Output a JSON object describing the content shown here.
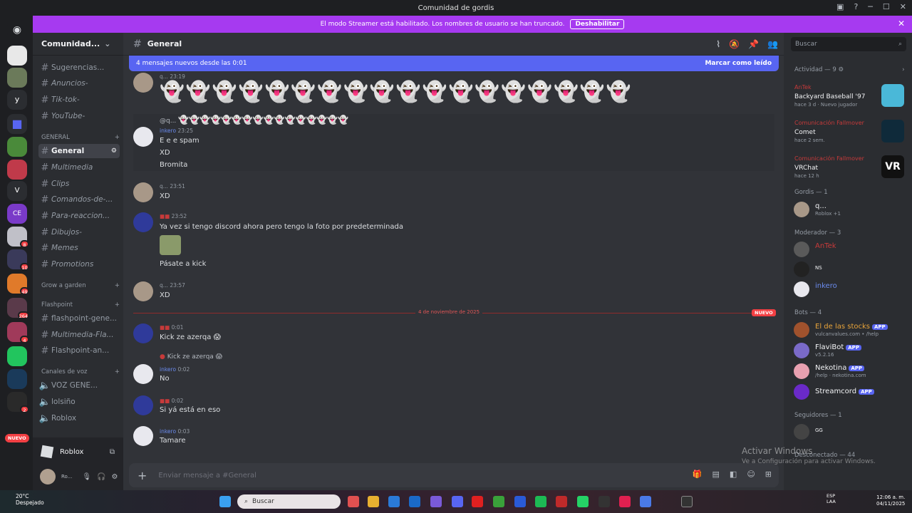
{
  "titlebar": {
    "title": "Comunidad de gordis"
  },
  "banner": {
    "text": "El modo Streamer está habilitado. Los nombres de usuario se han truncado.",
    "button": "Deshabilitar"
  },
  "server": {
    "name": "Comunidad..."
  },
  "channels": {
    "top": [
      {
        "name": "Sugerencias..."
      },
      {
        "name": "Anuncios-"
      },
      {
        "name": "Tik-tok-"
      },
      {
        "name": "YouTube-"
      }
    ],
    "cat_general": "GENERAL",
    "general": [
      {
        "name": "General"
      },
      {
        "name": "Multimedia"
      },
      {
        "name": "Clips"
      },
      {
        "name": "Comandos-de-..."
      },
      {
        "name": "Para-reaccion..."
      },
      {
        "name": "Dibujos-"
      },
      {
        "name": "Memes"
      },
      {
        "name": "Promotions"
      }
    ],
    "cat_grow": "Grow a garden",
    "cat_flash": "Flashpoint",
    "flash": [
      {
        "name": "flashpoint-gene..."
      },
      {
        "name": "Multimedia-Fla..."
      },
      {
        "name": "Flashpoint-an..."
      }
    ],
    "cat_voice": "Canales de voz",
    "voice": [
      {
        "name": "VOZ GENE..."
      },
      {
        "name": "lolsiño"
      },
      {
        "name": "Roblox"
      }
    ]
  },
  "rail": {
    "nuevo": "NUEVO",
    "badges": [
      "8",
      "10",
      "49",
      "264",
      "4",
      "2"
    ]
  },
  "voice_panel": {
    "activity": "Roblox"
  },
  "user_panel": {
    "status": "Ro..."
  },
  "channel_header": {
    "name": "General"
  },
  "new_messages": {
    "text": "4 mensajes nuevos desde las 0:01",
    "mark": "Marcar como leído"
  },
  "messages": {
    "m0_time": "23:19",
    "m0_author": "q...",
    "m1_reply_author": "@q...",
    "m1_author": "inkero",
    "m1_time": "23:25",
    "m1_l1": "E e e spam",
    "m1_l2": "XD",
    "m1_l3": "Bromita",
    "m2_author": "q...",
    "m2_time": "23:51",
    "m2_l1": "XD",
    "m3_time": "23:52",
    "m3_l1": "Ya vez si tengo discord ahora pero tengo la foto por predeterminada",
    "m3_l2": "Pásate a kick",
    "m4_author": "q...",
    "m4_time": "23:57",
    "m4_l1": "XD",
    "sep_date": "4 de noviembre de 2025",
    "sep_new": "NUEVO",
    "m5_time": "0:01",
    "m5_l1": "Kick ze azerqa 😱",
    "m6_reply": "Kick ze azerqa 😱",
    "m6_author": "inkero",
    "m6_time": "0:02",
    "m6_l1": "No",
    "m7_time": "0:02",
    "m7_l1": "Si yá está en eso",
    "m8_author": "inkero",
    "m8_time": "0:03",
    "m8_l1": "Tamare"
  },
  "composer": {
    "placeholder": "Enviar mensaje a #General"
  },
  "members": {
    "search": "Buscar",
    "activity_title": "Actividad — 9",
    "activities": [
      {
        "name": "AnTek",
        "game": "Backyard Baseball '97",
        "time": "hace 3 d · Nuevo jugador"
      },
      {
        "name": "Comunicación Fallmover",
        "game": "Comet",
        "time": "hace 2 sem."
      },
      {
        "name": "Comunicación Fallmover",
        "game": "VRChat",
        "time": "hace 12 h"
      }
    ],
    "gordis_title": "Gordis — 1",
    "gordis": [
      {
        "name": "q...",
        "sub": "Roblox +1"
      }
    ],
    "mod_title": "Moderador — 3",
    "mods": [
      {
        "name": "AnTek"
      },
      {
        "name": "NS"
      },
      {
        "name": "inkero"
      }
    ],
    "bots_title": "Bots — 4",
    "bots": [
      {
        "name": "El de las stocks",
        "sub": "vulcanvalues.com • /help",
        "app": "APP"
      },
      {
        "name": "FlaviBot",
        "sub": "v5.2.16",
        "app": "APP"
      },
      {
        "name": "Nekotina",
        "sub": "/help · nekotina.com",
        "app": "APP"
      },
      {
        "name": "Streamcord",
        "sub": "",
        "app": "APP"
      }
    ],
    "followers_title": "Seguidores — 1",
    "followers": [
      {
        "name": "GG"
      }
    ],
    "offline_title": "Desconectado — 44"
  },
  "watermark": {
    "l1": "Activar Windows",
    "l2": "Ve a Configuración para activar Windows."
  },
  "taskbar": {
    "search": "Buscar",
    "weather_temp": "20°C",
    "weather_text": "Despejado",
    "lang1": "ESP",
    "lang2": "LAA",
    "time": "12:06 a. m.",
    "date": "04/11/2025"
  }
}
